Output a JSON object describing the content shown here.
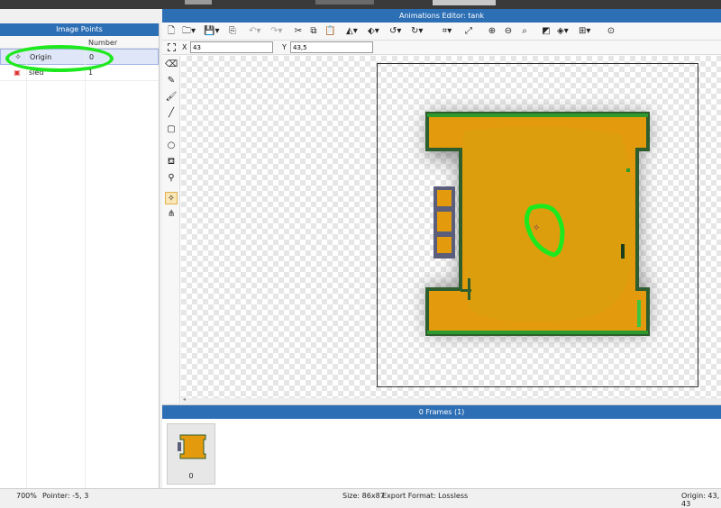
{
  "left_panel": {
    "title": "Image Points",
    "columns": {
      "name": "",
      "number": "Number"
    },
    "rows": [
      {
        "icon": "origin-point-icon",
        "name": "Origin",
        "number": "0"
      },
      {
        "icon": "sled-point-icon",
        "name": "sled",
        "number": "1"
      }
    ]
  },
  "editor": {
    "title": "Animations Editor: tank",
    "x_label": "X",
    "x_value": "43",
    "y_label": "Y",
    "y_value": "43,5"
  },
  "frames": {
    "title": "0 Frames (1)",
    "items": [
      {
        "label": "0"
      }
    ]
  },
  "status": {
    "zoom": "700%",
    "pointer": "Pointer: -5, 3",
    "size": "Size: 86x87",
    "export": "Export Format: Lossless",
    "origin": "Origin: 43, 43"
  },
  "colors": {
    "accent": "#2d6fb5",
    "tank_body": "#e39a0c",
    "tank_outline": "#2e7d2e",
    "annotation": "#1ee81e"
  }
}
